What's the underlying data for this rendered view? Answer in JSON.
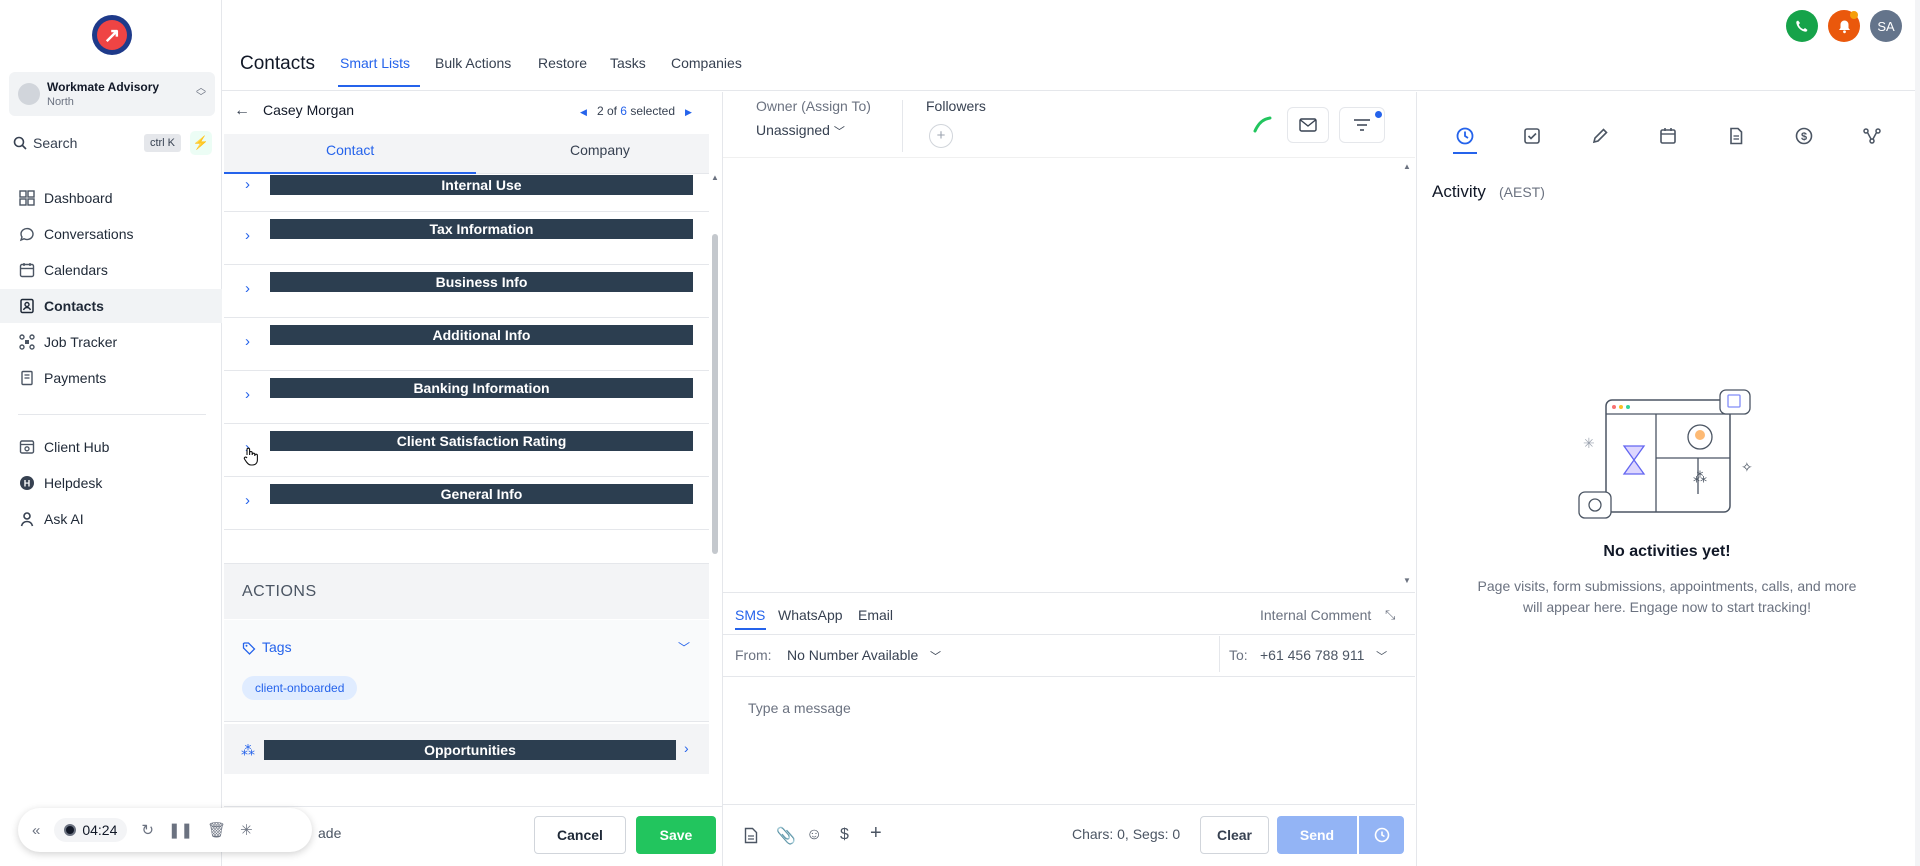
{
  "sidebar": {
    "account": {
      "name": "Workmate Advisory",
      "location": "North"
    },
    "search": {
      "label": "Search",
      "shortcut": "ctrl K"
    },
    "nav_main": [
      {
        "label": "Dashboard",
        "icon": "dashboard-icon"
      },
      {
        "label": "Conversations",
        "icon": "chat-icon"
      },
      {
        "label": "Calendars",
        "icon": "calendar-icon"
      },
      {
        "label": "Contacts",
        "icon": "contacts-icon",
        "active": true
      },
      {
        "label": "Job Tracker",
        "icon": "job-tracker-icon"
      },
      {
        "label": "Payments",
        "icon": "payments-icon"
      }
    ],
    "nav_secondary": [
      {
        "label": "Client Hub",
        "icon": "client-hub-icon"
      },
      {
        "label": "Helpdesk",
        "icon": "helpdesk-icon"
      },
      {
        "label": "Ask AI",
        "icon": "ask-ai-icon"
      }
    ]
  },
  "recorder": {
    "time": "04:24",
    "trailing_text": "ade"
  },
  "header": {
    "title": "Contacts",
    "tabs": [
      {
        "label": "Smart Lists",
        "active": true
      },
      {
        "label": "Bulk Actions"
      },
      {
        "label": "Restore"
      },
      {
        "label": "Tasks"
      },
      {
        "label": "Companies"
      }
    ],
    "avatar_initials": "SA"
  },
  "contact": {
    "name": "Casey Morgan",
    "pager": {
      "current": "2 of",
      "total": "6",
      "suffix": "selected"
    },
    "subtabs": [
      "Contact",
      "Company"
    ],
    "sections": [
      "Internal Use",
      "Tax Information",
      "Business Info",
      "Additional Info",
      "Banking Information",
      "Client Satisfaction Rating",
      "General Info"
    ],
    "actions_label": "ACTIONS",
    "tags_label": "Tags",
    "tags": [
      "client-onboarded"
    ],
    "opportunities_label": "Opportunities",
    "cancel_label": "Cancel",
    "save_label": "Save"
  },
  "middle": {
    "owner_label": "Owner (Assign To)",
    "owner_value": "Unassigned",
    "followers_label": "Followers",
    "composer": {
      "channels": [
        {
          "label": "SMS",
          "active": true
        },
        {
          "label": "WhatsApp"
        },
        {
          "label": "Email"
        }
      ],
      "internal_comment": "Internal Comment",
      "from_label": "From:",
      "from_value": "No Number Available",
      "to_label": "To:",
      "to_value": "+61 456 788 911",
      "placeholder": "Type a message",
      "counter": "Chars: 0, Segs: 0",
      "clear_label": "Clear",
      "send_label": "Send"
    }
  },
  "activity": {
    "title": "Activity",
    "timezone": "(AEST)",
    "empty_title": "No activities yet!",
    "empty_desc": "Page visits, form submissions, appointments, calls, and more will appear here. Engage now to start tracking!"
  },
  "colors": {
    "accent": "#2563eb",
    "section_bar": "#2c3e50",
    "save": "#22c55e",
    "send_disabled": "#93b4f5"
  }
}
